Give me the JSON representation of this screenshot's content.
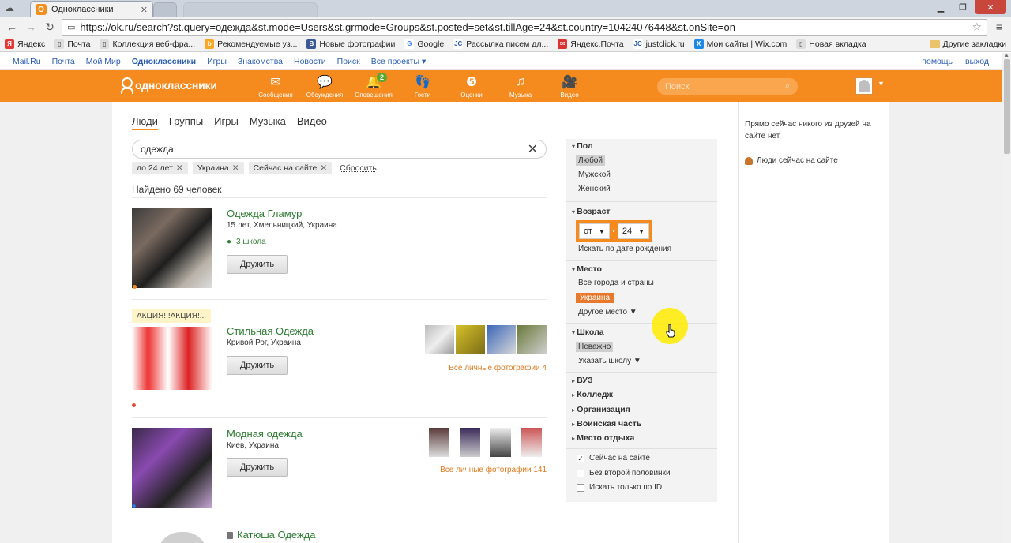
{
  "browser": {
    "tab_title": "Одноклассники",
    "url": "https://ok.ru/search?st.query=одежда&st.mode=Users&st.grmode=Groups&st.posted=set&st.tillAge=24&st.country=10424076448&st.onSite=on",
    "bookmarks": [
      "Яндекс",
      "Почта",
      "Коллекция веб-фра...",
      "Рекомендуемые уз...",
      "Новые фотографии",
      "Google",
      "Рассылка писем дл...",
      "Яндекс.Почта",
      "justclick.ru",
      "Мои сайты | Wix.com",
      "Новая вкладка"
    ],
    "bookmarks_other": "Другие закладки"
  },
  "mailru_bar": {
    "items": [
      "Mail.Ru",
      "Почта",
      "Мой Мир",
      "Одноклассники",
      "Игры",
      "Знакомства",
      "Новости",
      "Поиск",
      "Все проекты ▾"
    ],
    "right": [
      "помощь",
      "выход"
    ]
  },
  "ok_header": {
    "logo": "одноклассники",
    "nav": [
      "Сообщения",
      "Обсуждения",
      "Оповещения",
      "Гости",
      "Оценки",
      "Музыка",
      "Видео"
    ],
    "notifications_badge": "2",
    "search_placeholder": "Поиск"
  },
  "search": {
    "tabs": [
      "Люди",
      "Группы",
      "Игры",
      "Музыка",
      "Видео"
    ],
    "query": "одежда",
    "chips": [
      "до 24 лет",
      "Украина",
      "Сейчас на сайте"
    ],
    "reset": "Сбросить",
    "found": "Найдено 69 человек"
  },
  "results": [
    {
      "name": "Одежда Гламур",
      "meta": "15 лет, Хмельницкий, Украина",
      "school": "3 школа",
      "button": "Дружить"
    },
    {
      "name": "Стильная Одежда",
      "promo": "АКЦИЯ!!!АКЦИЯ!...",
      "meta": "Кривой Рог, Украина",
      "button": "Дружить",
      "all_photos": "Все личные фотографии 4"
    },
    {
      "name": "Модная одежда",
      "meta": "Киев, Украина",
      "button": "Дружить",
      "all_photos": "Все личные фотографии 141"
    },
    {
      "name": "Катюша Одежда"
    }
  ],
  "filters": {
    "gender": {
      "title": "Пол",
      "options": [
        "Любой",
        "Мужской",
        "Женский"
      ]
    },
    "age": {
      "title": "Возраст",
      "from": "от",
      "to": "24",
      "birthdate": "Искать по дате рождения"
    },
    "place": {
      "title": "Место",
      "options": [
        "Все города и страны",
        "Украина",
        "Другое место ▼"
      ]
    },
    "school": {
      "title": "Школа",
      "options": [
        "Неважно",
        "Указать школу ▼"
      ]
    },
    "collapsed": [
      "ВУЗ",
      "Колледж",
      "Организация",
      "Воинская часть",
      "Место отдыха"
    ],
    "checkboxes": [
      {
        "label": "Сейчас на сайте",
        "checked": true
      },
      {
        "label": "Без второй половинки",
        "checked": false
      },
      {
        "label": "Искать только по ID",
        "checked": false
      }
    ]
  },
  "right_column": {
    "no_friends": "Прямо сейчас никого из друзей на сайте нет.",
    "people_online": "Люди сейчас на сайте"
  }
}
